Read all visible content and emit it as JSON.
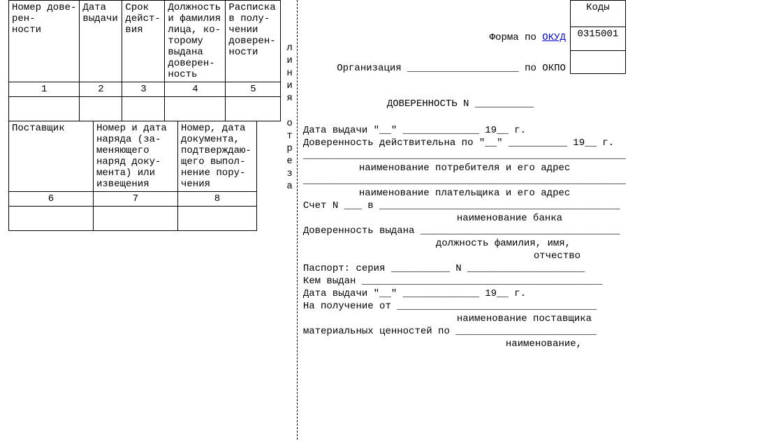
{
  "left": {
    "table1": {
      "headers": [
        "Номер дове-\nрен-\nности",
        "Дата\nвыдачи",
        "Срок\nдейст-\nвия",
        "Должность\nи фамилия\nлица, ко-\nторому\nвыдана\nдоверен-\nность",
        "Расписка\nв полу-\nчении\nдоверен-\nности"
      ],
      "nums": [
        "1",
        "2",
        "3",
        "4",
        "5"
      ]
    },
    "table2": {
      "headers": [
        "Поставщик",
        "Номер и дата\nнаряда (за-\nменяющего\nнаряд доку-\nмента) или\nизвещения",
        "Номер, дата\nдокумента,\nподтверждаю-\nщего выпол-\nнение пору-\nчения"
      ],
      "nums": [
        "6",
        "7",
        "8"
      ]
    }
  },
  "cut_label": "линия отреза",
  "right": {
    "kody_header": "Коды",
    "okud_row_pre": "Форма по ",
    "okud_link": "ОКУД",
    "okud_code": "0315001",
    "org_label": "Организация ",
    "okpo_label": " по ОКПО",
    "title": "ДОВЕРЕННОСТЬ N ",
    "date_issue": "Дата выдачи \"__\" _____________ 19__  г.",
    "valid_until": "Доверенность действительна по \"__\" __________ 19__  г.",
    "consumer_line": "_______________________________________________________",
    "consumer_sub": "наименование потребителя и его адрес",
    "payer_line": "_______________________________________________________",
    "payer_sub": "наименование плательщика и его адрес",
    "account": "Счет N ___ в _________________________________________",
    "bank_sub": "наименование банка",
    "issued_to": "Доверенность выдана __________________________________",
    "issued_sub": "должность   фамилия, имя,\n                           отчество",
    "passport": "Паспорт: серия __________ N ____________________",
    "issued_by": "Кем выдан _________________________________________",
    "issue_date2": "Дата выдачи \"__\" _____________ 19__  г.",
    "receive_from": "На получение от __________________________________",
    "supplier_sub": "наименование поставщика",
    "materials": "материальных ценностей по ________________________",
    "name_sub": "наименование,"
  }
}
